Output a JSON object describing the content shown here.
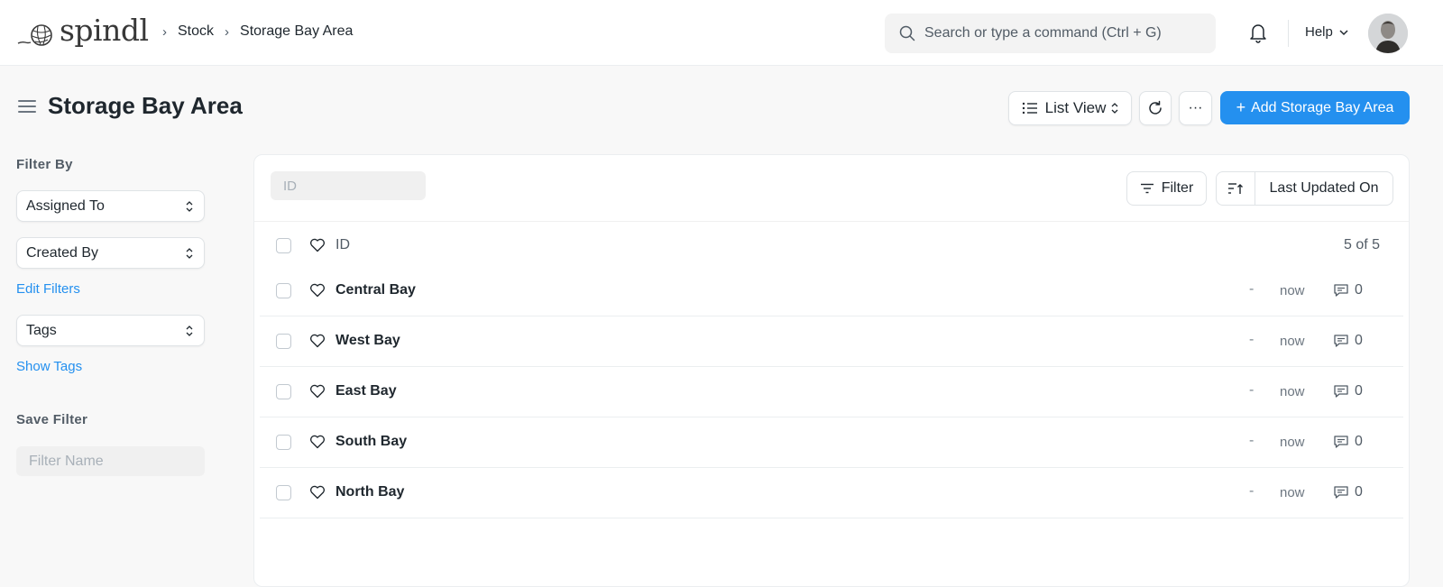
{
  "app": {
    "logo_text": "spindl"
  },
  "breadcrumb": [
    "Stock",
    "Storage Bay Area"
  ],
  "search": {
    "placeholder": "Search or type a command (Ctrl + G)"
  },
  "nav": {
    "help_label": "Help"
  },
  "page": {
    "title": "Storage Bay Area",
    "view_label": "List View",
    "more_label": "···",
    "add_label": "Add Storage Bay Area"
  },
  "sidebar": {
    "filter_by_heading": "Filter By",
    "assigned_to": "Assigned To",
    "created_by": "Created By",
    "edit_filters": "Edit Filters",
    "tags": "Tags",
    "show_tags": "Show Tags",
    "save_filter_heading": "Save Filter",
    "filter_name_placeholder": "Filter Name"
  },
  "list": {
    "id_filter_placeholder": "ID",
    "filter_label": "Filter",
    "sort_label": "Last Updated On",
    "header_id": "ID",
    "count": "5 of 5",
    "rows": [
      {
        "name": "Central Bay",
        "assigned": "-",
        "modified": "now",
        "comments": "0"
      },
      {
        "name": "West Bay",
        "assigned": "-",
        "modified": "now",
        "comments": "0"
      },
      {
        "name": "East Bay",
        "assigned": "-",
        "modified": "now",
        "comments": "0"
      },
      {
        "name": "South Bay",
        "assigned": "-",
        "modified": "now",
        "comments": "0"
      },
      {
        "name": "North Bay",
        "assigned": "-",
        "modified": "now",
        "comments": "0"
      }
    ]
  },
  "colors": {
    "accent": "#2490ef",
    "text": "#1f272e",
    "muted": "#525c66"
  }
}
